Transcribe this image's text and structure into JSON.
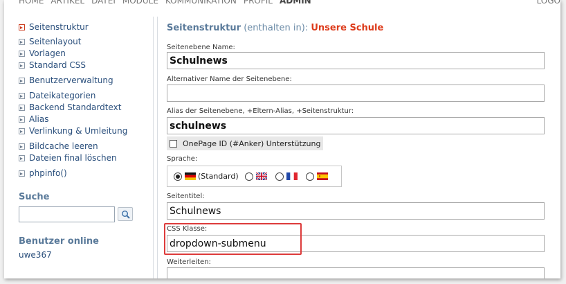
{
  "topnav": {
    "items": [
      "HOME",
      "ARTIKEL",
      "DATEI",
      "MODULE",
      "KOMMUNIKATION",
      "PROFIL",
      "ADMIN"
    ],
    "active_index": 6,
    "logout": "LOGO"
  },
  "sidebar": {
    "links": [
      "Seitenstruktur",
      "Seitenlayout",
      "Vorlagen",
      "Standard CSS",
      "Benutzerverwaltung",
      "Dateikategorien",
      "Backend Standardtext",
      "Alias",
      "Verlinkung & Umleitung",
      "Bildcache leeren",
      "Dateien final löschen",
      "phpinfo()"
    ],
    "current_index": 0,
    "search_heading": "Suche",
    "search_value": "",
    "online_heading": "Benutzer online",
    "online_user": "uwe367"
  },
  "main": {
    "heading_main": "Seitenstruktur",
    "heading_sub": " (enthalten in): ",
    "heading_parent": "Unsere Schule",
    "fields": {
      "name_label": "Seitenebene Name:",
      "name_value": "Schulnews",
      "alt_label": "Alternativer Name der Seitenebene:",
      "alt_value": "",
      "alias_label": "Alias der Seitenebene, +Eltern-Alias, +Seitenstruktur:",
      "alias_value": "schulnews",
      "onepage_label": "OnePage ID (#Anker) Unterstützung",
      "lang_label": "Sprache:",
      "lang_default": "(Standard)",
      "lang_selected": "de",
      "title_label": "Seitentitel:",
      "title_value": "Schulnews",
      "css_label": "CSS Klasse:",
      "css_value": "dropdown-submenu",
      "redirect_label": "Weiterleiten:",
      "redirect_value": ""
    }
  },
  "colors": {
    "accent_red": "#dd3b1b",
    "link_blue": "#2a4f7c",
    "heading_blue": "#5a7a9a",
    "highlight": "#dd3b3b"
  }
}
